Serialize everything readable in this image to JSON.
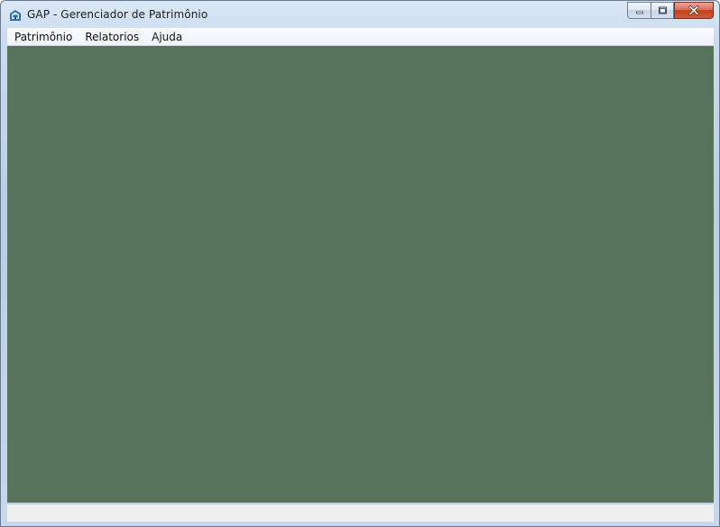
{
  "window": {
    "title": "GAP - Gerenciador de Patrimônio",
    "icon": "app-icon",
    "buttons": [
      "minimize-icon",
      "maximize-icon",
      "close-icon"
    ]
  },
  "menu": {
    "items": [
      {
        "label": "Patrimônio"
      },
      {
        "label": "Relatorios"
      },
      {
        "label": "Ajuda"
      }
    ]
  },
  "colors": {
    "client_background": "#58735c",
    "status_background": "#f0f0f0",
    "close_button": "#c2401f"
  },
  "statusbar": {
    "text": ""
  }
}
